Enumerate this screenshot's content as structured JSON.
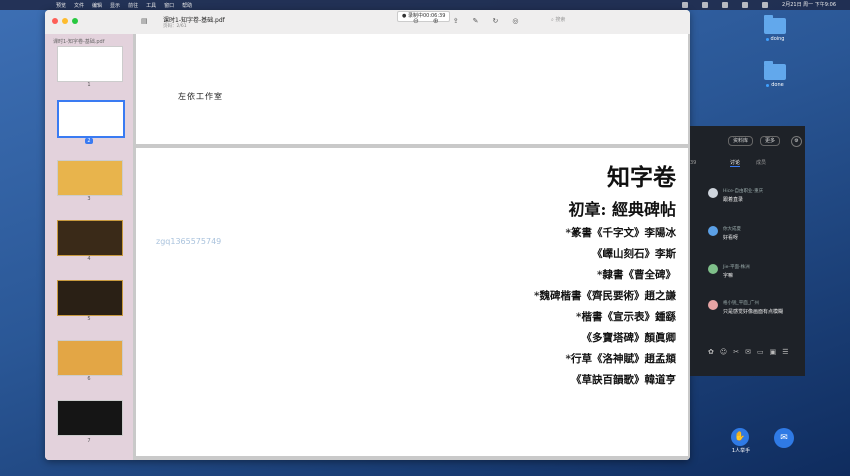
{
  "menubar": {
    "app": "预览",
    "items": [
      "文件",
      "编辑",
      "显示",
      "前往",
      "工具",
      "窗口",
      "帮助"
    ],
    "datetime": "2月21日 周一 下午9:06"
  },
  "desktop": {
    "folders": [
      {
        "name": "doing"
      },
      {
        "name": "done"
      }
    ]
  },
  "window": {
    "title": "课时1-知字卷-基础.pdf",
    "subtitle": "页码：2/61",
    "search_placeholder": "搜索",
    "recording": "● 录制中00:06:39"
  },
  "sidebar": {
    "header": "课时1-知字卷-基础.pdf",
    "page_numbers": [
      "1",
      "2",
      "3",
      "4",
      "5",
      "6",
      "7"
    ],
    "selected": "2"
  },
  "page1": {
    "studio": "左依工作室"
  },
  "page2": {
    "title": "知字卷",
    "chapter": "初章: 經典碑帖",
    "watermark": "zgq1365575749",
    "items": [
      "*篆書《千字文》李陽冰",
      "《嶧山刻石》李斯",
      "*隸書《曹全碑》",
      "*魏碑楷書《齊民要術》趙之謙",
      "*楷書《宣示表》鍾繇",
      "《多寶塔碑》顏眞卿",
      "*行草《洛神賦》趙孟頫",
      "《草訣百韻歌》韓道亨"
    ]
  },
  "chat": {
    "btn_material": "资料库",
    "btn_more": "更多",
    "tab_discuss": "讨论",
    "tab_members": "成员",
    "side_number": "39",
    "messages": [
      {
        "name": "Hice-自由职业-重庆",
        "text": "跟着直录"
      },
      {
        "name": "你大成夏",
        "text": "好看呀"
      },
      {
        "name": "Jie-平面-株洲",
        "text": "字嘛"
      },
      {
        "name": "格小锐_平面_广州",
        "text": "只是感觉好像画面有点模糊"
      }
    ]
  },
  "hand_raise_label": "1人举手",
  "colors": {
    "accent": "#3a7bf2",
    "sidebar_bg": "#e3d2dc",
    "chat_bg": "#1e2228"
  }
}
